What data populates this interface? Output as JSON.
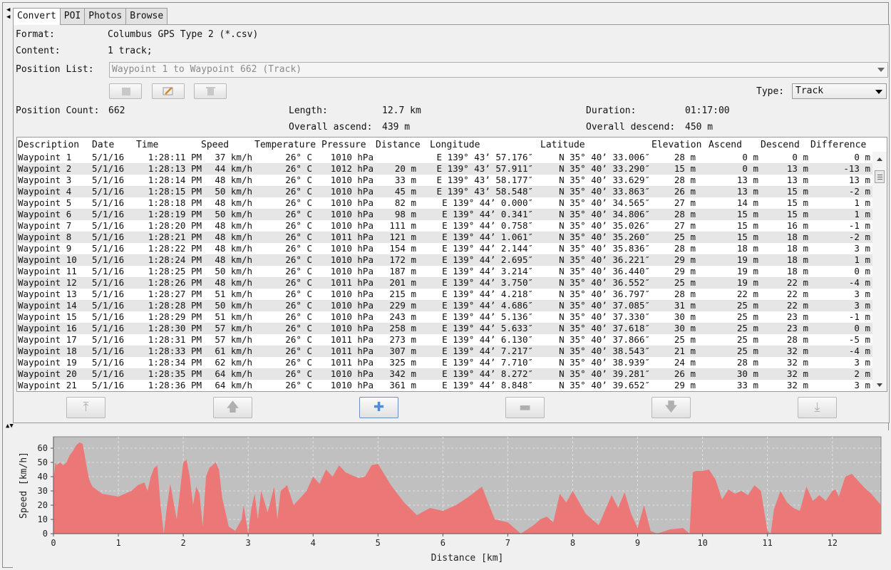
{
  "tabs": [
    "Convert",
    "POI",
    "Photos",
    "Browse"
  ],
  "info": {
    "format_label": "Format:",
    "format_value": "Columbus GPS Type 2 (*.csv)",
    "content_label": "Content:",
    "content_value": "1 track;",
    "position_list_label": "Position List:",
    "position_list_value": "Waypoint 1 to Waypoint 662 (Track)",
    "type_label": "Type:",
    "type_value": "Track",
    "position_count_label": "Position Count:",
    "position_count_value": "662",
    "length_label": "Length:",
    "length_value": "12.7 km",
    "duration_label": "Duration:",
    "duration_value": "01:17:00",
    "ascend_label": "Overall ascend:",
    "ascend_value": "439 m",
    "descend_label": "Overall descend:",
    "descend_value": "450 m"
  },
  "table": {
    "headers": [
      "Description",
      "Date",
      "Time",
      "Speed",
      "Temperature",
      "Pressure",
      "Distance",
      "Longitude",
      "Latitude",
      "Elevation",
      "Ascend",
      "Descend",
      "Difference"
    ],
    "rows": [
      [
        "Waypoint 1",
        "5/1/16",
        "1:28:11 PM",
        "37 km/h",
        "26° C",
        "1010 hPa",
        "",
        "E 139°  43’  57.176″",
        "N 35°  40’  33.006″",
        "28 m",
        "0 m",
        "0 m",
        "0 m"
      ],
      [
        "Waypoint 2",
        "5/1/16",
        "1:28:13 PM",
        "44 km/h",
        "26° C",
        "1012 hPa",
        "20 m",
        "E 139°  43’  57.911″",
        "N 35°  40’  33.290″",
        "15 m",
        "0 m",
        "13 m",
        "-13 m"
      ],
      [
        "Waypoint 3",
        "5/1/16",
        "1:28:14 PM",
        "48 km/h",
        "26° C",
        "1010 hPa",
        "33 m",
        "E 139°  43’  58.177″",
        "N 35°  40’  33.629″",
        "28 m",
        "13 m",
        "13 m",
        "13 m"
      ],
      [
        "Waypoint 4",
        "5/1/16",
        "1:28:15 PM",
        "50 km/h",
        "26° C",
        "1010 hPa",
        "45 m",
        "E 139°  43’  58.548″",
        "N 35°  40’  33.863″",
        "26 m",
        "13 m",
        "15 m",
        "-2 m"
      ],
      [
        "Waypoint 5",
        "5/1/16",
        "1:28:18 PM",
        "48 km/h",
        "26° C",
        "1010 hPa",
        "82 m",
        "E 139°  44’  0.000″",
        "N 35°  40’  34.565″",
        "27 m",
        "14 m",
        "15 m",
        "1 m"
      ],
      [
        "Waypoint 6",
        "5/1/16",
        "1:28:19 PM",
        "50 km/h",
        "26° C",
        "1010 hPa",
        "98 m",
        "E 139°  44’  0.341″",
        "N 35°  40’  34.806″",
        "28 m",
        "15 m",
        "15 m",
        "1 m"
      ],
      [
        "Waypoint 7",
        "5/1/16",
        "1:28:20 PM",
        "48 km/h",
        "26° C",
        "1010 hPa",
        "111 m",
        "E 139°  44’  0.758″",
        "N 35°  40’  35.026″",
        "27 m",
        "15 m",
        "16 m",
        "-1 m"
      ],
      [
        "Waypoint 8",
        "5/1/16",
        "1:28:21 PM",
        "48 km/h",
        "26° C",
        "1011 hPa",
        "121 m",
        "E 139°  44’  1.061″",
        "N 35°  40’  35.260″",
        "25 m",
        "15 m",
        "18 m",
        "-2 m"
      ],
      [
        "Waypoint 9",
        "5/1/16",
        "1:28:22 PM",
        "48 km/h",
        "26° C",
        "1010 hPa",
        "154 m",
        "E 139°  44’  2.144″",
        "N 35°  40’  35.836″",
        "28 m",
        "18 m",
        "18 m",
        "3 m"
      ],
      [
        "Waypoint 10",
        "5/1/16",
        "1:28:24 PM",
        "48 km/h",
        "26° C",
        "1010 hPa",
        "172 m",
        "E 139°  44’  2.695″",
        "N 35°  40’  36.221″",
        "29 m",
        "19 m",
        "18 m",
        "1 m"
      ],
      [
        "Waypoint 11",
        "5/1/16",
        "1:28:25 PM",
        "50 km/h",
        "26° C",
        "1010 hPa",
        "187 m",
        "E 139°  44’  3.214″",
        "N 35°  40’  36.440″",
        "29 m",
        "19 m",
        "18 m",
        "0 m"
      ],
      [
        "Waypoint 12",
        "5/1/16",
        "1:28:26 PM",
        "48 km/h",
        "26° C",
        "1011 hPa",
        "201 m",
        "E 139°  44’  3.750″",
        "N 35°  40’  36.552″",
        "25 m",
        "19 m",
        "22 m",
        "-4 m"
      ],
      [
        "Waypoint 13",
        "5/1/16",
        "1:28:27 PM",
        "51 km/h",
        "26° C",
        "1010 hPa",
        "215 m",
        "E 139°  44’  4.218″",
        "N 35°  40’  36.797″",
        "28 m",
        "22 m",
        "22 m",
        "3 m"
      ],
      [
        "Waypoint 14",
        "5/1/16",
        "1:28:28 PM",
        "50 km/h",
        "26° C",
        "1010 hPa",
        "229 m",
        "E 139°  44’  4.686″",
        "N 35°  40’  37.085″",
        "31 m",
        "25 m",
        "22 m",
        "3 m"
      ],
      [
        "Waypoint 15",
        "5/1/16",
        "1:28:29 PM",
        "51 km/h",
        "26° C",
        "1010 hPa",
        "243 m",
        "E 139°  44’  5.136″",
        "N 35°  40’  37.330″",
        "30 m",
        "25 m",
        "23 m",
        "-1 m"
      ],
      [
        "Waypoint 16",
        "5/1/16",
        "1:28:30 PM",
        "57 km/h",
        "26° C",
        "1010 hPa",
        "258 m",
        "E 139°  44’  5.633″",
        "N 35°  40’  37.618″",
        "30 m",
        "25 m",
        "23 m",
        "0 m"
      ],
      [
        "Waypoint 17",
        "5/1/16",
        "1:28:31 PM",
        "57 km/h",
        "26° C",
        "1011 hPa",
        "273 m",
        "E 139°  44’  6.130″",
        "N 35°  40’  37.866″",
        "25 m",
        "25 m",
        "28 m",
        "-5 m"
      ],
      [
        "Waypoint 18",
        "5/1/16",
        "1:28:33 PM",
        "61 km/h",
        "26° C",
        "1011 hPa",
        "307 m",
        "E 139°  44’  7.217″",
        "N 35°  40’  38.543″",
        "21 m",
        "25 m",
        "32 m",
        "-4 m"
      ],
      [
        "Waypoint 19",
        "5/1/16",
        "1:28:34 PM",
        "62 km/h",
        "26° C",
        "1011 hPa",
        "325 m",
        "E 139°  44’  7.710″",
        "N 35°  40’  38.939″",
        "24 m",
        "28 m",
        "32 m",
        "3 m"
      ],
      [
        "Waypoint 20",
        "5/1/16",
        "1:28:35 PM",
        "64 km/h",
        "26° C",
        "1010 hPa",
        "342 m",
        "E 139°  44’  8.272″",
        "N 35°  40’  39.281″",
        "26 m",
        "30 m",
        "32 m",
        "2 m"
      ],
      [
        "Waypoint 21",
        "5/1/16",
        "1:28:36 PM",
        "64 km/h",
        "26° C",
        "1010 hPa",
        "361 m",
        "E 139°  44’  8.848″",
        "N 35°  40’  39.652″",
        "29 m",
        "33 m",
        "32 m",
        "3 m"
      ]
    ]
  },
  "toolbar_icons": [
    "stop-icon",
    "edit-icon",
    "delete-icon"
  ],
  "nav_icons": [
    "move-top-icon",
    "move-up-icon",
    "add-icon",
    "remove-icon",
    "move-down-icon",
    "move-bottom-icon"
  ],
  "colors": {
    "fill": "#ec7777",
    "plot_bg": "#c0c0c0",
    "accent": "#4f8ed6"
  },
  "chart_data": {
    "type": "area",
    "xlabel": "Distance [km]",
    "ylabel": "Speed [km/h]",
    "xlim": [
      0,
      12.75
    ],
    "ylim": [
      0,
      68
    ],
    "xticks": [
      0,
      1,
      2,
      3,
      4,
      5,
      6,
      7,
      8,
      9,
      10,
      11,
      12
    ],
    "yticks": [
      0,
      10,
      20,
      30,
      40,
      50,
      60
    ],
    "grid": true,
    "x": [
      0,
      0.03,
      0.05,
      0.1,
      0.15,
      0.2,
      0.25,
      0.3,
      0.35,
      0.4,
      0.45,
      0.5,
      0.55,
      0.6,
      0.75,
      1.0,
      1.2,
      1.3,
      1.4,
      1.45,
      1.5,
      1.55,
      1.6,
      1.65,
      1.7,
      1.75,
      1.8,
      1.9,
      2.0,
      2.05,
      2.1,
      2.15,
      2.2,
      2.25,
      2.3,
      2.35,
      2.4,
      2.45,
      2.5,
      2.55,
      2.6,
      2.7,
      2.8,
      2.9,
      2.93,
      3.0,
      3.05,
      3.1,
      3.15,
      3.2,
      3.3,
      3.4,
      3.45,
      3.5,
      3.6,
      3.7,
      3.8,
      3.9,
      4.0,
      4.1,
      4.2,
      4.3,
      4.4,
      4.5,
      4.7,
      4.8,
      4.9,
      5.0,
      5.2,
      5.4,
      5.6,
      5.8,
      6.0,
      6.2,
      6.4,
      6.6,
      6.8,
      7.0,
      7.2,
      7.3,
      7.4,
      7.5,
      7.6,
      7.7,
      7.8,
      7.9,
      8.0,
      8.2,
      8.4,
      8.6,
      8.7,
      8.8,
      8.9,
      9.0,
      9.1,
      9.2,
      9.3,
      9.5,
      9.7,
      9.8,
      9.85,
      9.9,
      10.0,
      10.1,
      10.2,
      10.3,
      10.4,
      10.5,
      10.6,
      10.7,
      10.8,
      10.9,
      11.0,
      11.05,
      11.1,
      11.2,
      11.3,
      11.4,
      11.5,
      11.6,
      11.7,
      11.8,
      11.9,
      12.0,
      12.05,
      12.1,
      12.2,
      12.3,
      12.4,
      12.5,
      12.6,
      12.75
    ],
    "y": [
      37,
      50,
      48,
      50,
      48,
      50,
      55,
      58,
      62,
      64,
      63,
      50,
      38,
      33,
      28,
      26,
      30,
      34,
      36,
      30,
      40,
      46,
      48,
      20,
      0,
      20,
      35,
      10,
      50,
      52,
      40,
      20,
      33,
      28,
      5,
      40,
      46,
      48,
      50,
      45,
      25,
      5,
      2,
      10,
      20,
      0,
      18,
      28,
      10,
      30,
      15,
      33,
      10,
      30,
      34,
      20,
      25,
      30,
      40,
      35,
      45,
      40,
      48,
      43,
      39,
      40,
      48,
      49,
      34,
      22,
      13,
      18,
      16,
      20,
      26,
      33,
      10,
      8,
      0,
      3,
      6,
      10,
      12,
      8,
      28,
      22,
      30,
      14,
      6,
      27,
      18,
      29,
      14,
      4,
      20,
      2,
      0,
      3,
      4,
      0,
      43,
      44,
      44,
      45,
      38,
      24,
      31,
      28,
      30,
      27,
      34,
      30,
      2,
      0,
      17,
      30,
      22,
      18,
      16,
      33,
      23,
      27,
      23,
      30,
      31,
      26,
      40,
      42,
      37,
      32,
      28,
      20,
      12
    ]
  }
}
